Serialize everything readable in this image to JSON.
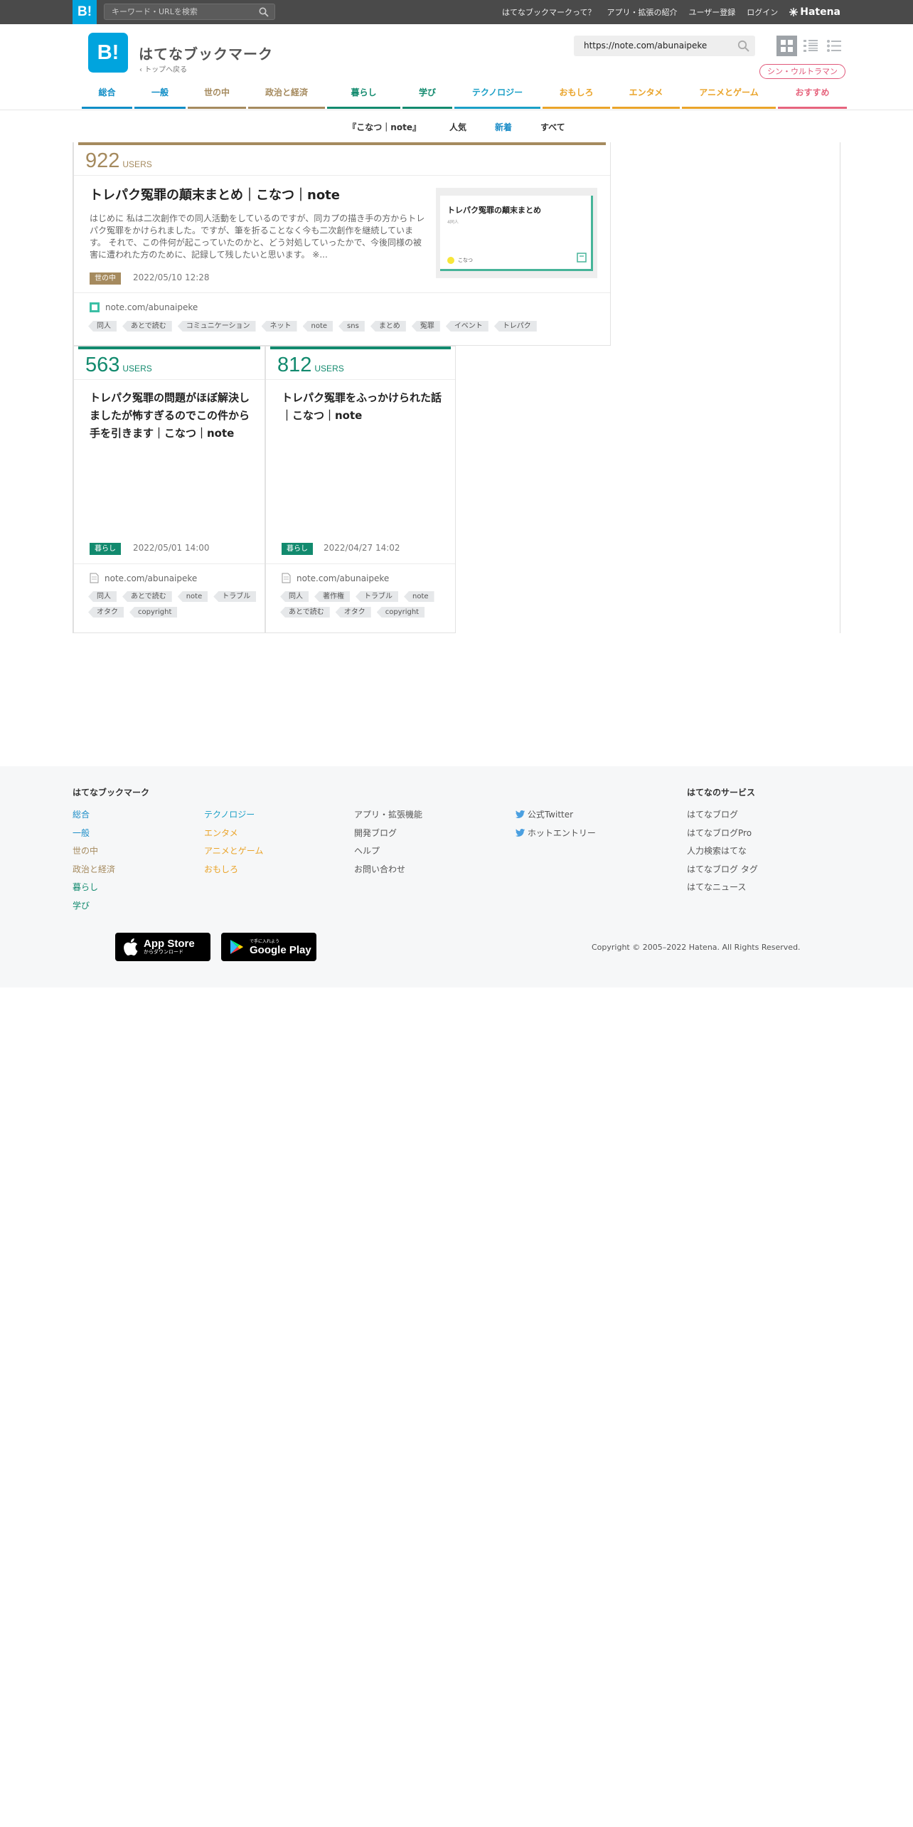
{
  "topbar": {
    "logo": "B!",
    "search_placeholder": "キーワード・URLを検索",
    "nav": [
      "はてなブックマークって？",
      "アプリ・拡張の紹介",
      "ユーザー登録",
      "ログイン"
    ],
    "hatena": "Hatena"
  },
  "header": {
    "logo": "B!",
    "title": "はてなブックマーク",
    "back": "トップへ戻る",
    "url_value": "https://note.com/abunaipeke",
    "pill": "シン・ウルトラマン"
  },
  "categories": [
    {
      "label": "総合",
      "color": "#0e8dc6"
    },
    {
      "label": "一般",
      "color": "#0e8dc6"
    },
    {
      "label": "世の中",
      "color": "#a58a5e"
    },
    {
      "label": "政治と経済",
      "color": "#a58a5e"
    },
    {
      "label": "暮らし",
      "color": "#128a6e"
    },
    {
      "label": "学び",
      "color": "#128a6e"
    },
    {
      "label": "テクノロジー",
      "color": "#1a9fc6"
    },
    {
      "label": "おもしろ",
      "color": "#eaa42a"
    },
    {
      "label": "エンタメ",
      "color": "#eaa42a"
    },
    {
      "label": "アニメとゲーム",
      "color": "#eaa42a"
    },
    {
      "label": "おすすめ",
      "color": "#e6647d"
    }
  ],
  "subnav": {
    "site": "『こなつ｜note』",
    "tabs": [
      "人気",
      "新着",
      "すべて"
    ],
    "active_tab": "新着"
  },
  "entries": [
    {
      "users": "922",
      "users_label": "USERS",
      "title": "トレパク冤罪の顛末まとめ｜こなつ｜note",
      "description": "はじめに 私は二次創作での同人活動をしているのですが、同カプの描き手の方からトレパク冤罪をかけられました。ですが、筆を折ることなく今も二次創作を継続しています。 それで、この件何が起こっていたのかと、どう対処していったかで、今後同様の被害に遭われた方のために、記録して残したいと思います。 ※...",
      "category": "世の中",
      "date": "2022/05/10 12:28",
      "source": "note.com/abunaipeke",
      "tags": [
        "同人",
        "あとで読む",
        "コミュニケーション",
        "ネット",
        "note",
        "sns",
        "まとめ",
        "冤罪",
        "イベント",
        "トレパク"
      ],
      "thumb_title": "トレパク冤罪の顛末まとめ",
      "thumb_sub": "4同人",
      "thumb_author": "こなつ"
    },
    {
      "users": "563",
      "users_label": "USERS",
      "title": "トレパク冤罪の問題がほぼ解決しましたが怖すぎるのでこの件から手を引きます｜こなつ｜note",
      "category": "暮らし",
      "date": "2022/05/01 14:00",
      "source": "note.com/abunaipeke",
      "tags": [
        "同人",
        "あとで読む",
        "note",
        "トラブル",
        "オタク",
        "copyright"
      ]
    },
    {
      "users": "812",
      "users_label": "USERS",
      "title": "トレパク冤罪をふっかけられた話｜こなつ｜note",
      "category": "暮らし",
      "date": "2022/04/27 14:02",
      "source": "note.com/abunaipeke",
      "tags": [
        "同人",
        "著作権",
        "トラブル",
        "note",
        "あとで読む",
        "オタク",
        "copyright"
      ]
    }
  ],
  "footer": {
    "heading": "はてなブックマーク",
    "col1": [
      {
        "label": "総合",
        "color": "#1a8cc7"
      },
      {
        "label": "一般",
        "color": "#1a8cc7"
      },
      {
        "label": "世の中",
        "color": "#a58a5e"
      },
      {
        "label": "政治と経済",
        "color": "#a58a5e"
      },
      {
        "label": "暮らし",
        "color": "#128a6e"
      },
      {
        "label": "学び",
        "color": "#128a6e"
      }
    ],
    "col2": [
      {
        "label": "テクノロジー",
        "color": "#1a9fc6"
      },
      {
        "label": "エンタメ",
        "color": "#eaa42a"
      },
      {
        "label": "アニメとゲーム",
        "color": "#eaa42a"
      },
      {
        "label": "おもしろ",
        "color": "#eaa42a"
      }
    ],
    "col3": [
      "アプリ・拡張機能",
      "開発ブログ",
      "ヘルプ",
      "お問い合わせ"
    ],
    "col4": [
      "公式Twitter",
      "ホットエントリー"
    ],
    "services_heading": "はてなのサービス",
    "services": [
      "はてなブログ",
      "はてなブログPro",
      "人力検索はてな",
      "はてなブログ タグ",
      "はてなニュース"
    ],
    "appstore_small": "からダウンロード",
    "appstore_big": "App Store",
    "googleplay_small": "で手に入れよう",
    "googleplay_big": "Google Play",
    "copyright": "Copyright © 2005–2022 Hatena. All Rights Reserved."
  }
}
